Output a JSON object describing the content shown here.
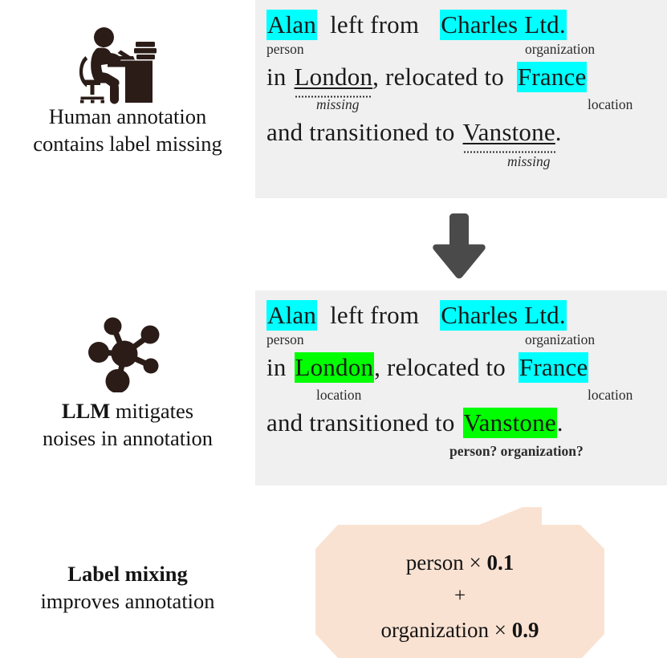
{
  "figure": {
    "rows": [
      {
        "id": "human",
        "caption_line1": "Human annotation",
        "caption_line2": "contains label missing",
        "icon": "person-at-desk-icon"
      },
      {
        "id": "llm",
        "caption_bold": "LLM",
        "caption_rest": " mitigates",
        "caption_line2": "noises in annotation",
        "icon": "molecule-network-icon"
      },
      {
        "id": "mixing",
        "caption_bold": "Label mixing",
        "caption_line2": "improves annotation"
      }
    ],
    "transition_icon": "down-arrow-icon"
  },
  "panel_human": {
    "line1": {
      "t_alan": "Alan",
      "t_left_from": "left  from",
      "t_charles": "Charles  Ltd."
    },
    "labels1": {
      "person": "person",
      "organization": "organization"
    },
    "line2": {
      "t_in": "in",
      "t_london": "London",
      "t_comma_reloc": ", relocated  to",
      "t_france": "France"
    },
    "labels2": {
      "missing": "missing",
      "location": "location"
    },
    "line3": {
      "t_and": "and transitioned to",
      "t_vanstone": "Vanstone",
      "t_period": "."
    },
    "labels3": {
      "missing": "missing"
    }
  },
  "panel_llm": {
    "line1": {
      "t_alan": "Alan",
      "t_left_from": "left  from",
      "t_charles": "Charles  Ltd."
    },
    "labels1": {
      "person": "person",
      "organization": "organization"
    },
    "line2": {
      "t_in": "in",
      "t_london": "London",
      "t_comma_reloc": ", relocated  to",
      "t_france": "France"
    },
    "labels2": {
      "location_left": "location",
      "location_right": "location"
    },
    "line3": {
      "t_and": "and transitioned to",
      "t_vanstone": "Vanstone",
      "t_period": "."
    },
    "labels3": {
      "question": "person? organization?"
    }
  },
  "callout": {
    "line1_label": "person",
    "line1_times": "×",
    "line1_weight": "0.1",
    "line2_plus": "+",
    "line3_label": "organization",
    "line3_times": "×",
    "line3_weight": "0.9"
  },
  "colors": {
    "panel_bg": "#f0f0f0",
    "page_bg": "#ffffff",
    "highlight_cyan": "#00ffff",
    "highlight_green": "#00ff00",
    "callout_bg": "#fae2d2",
    "arrow": "#4a4a4a",
    "icon": "#2b1c18",
    "text": "#141414"
  }
}
